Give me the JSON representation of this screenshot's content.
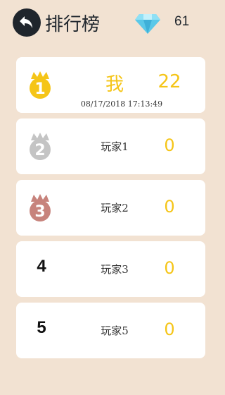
{
  "header": {
    "title": "排行榜",
    "gem_count": "61",
    "back_icon": "back-arrow-icon",
    "gem_icon": "diamond-icon"
  },
  "leaderboard": [
    {
      "rank": "1",
      "name": "我",
      "score": "22",
      "timestamp": "08/17/2018 17:13:49",
      "medal": "gold"
    },
    {
      "rank": "2",
      "name": "玩家1",
      "score": "0",
      "medal": "silver"
    },
    {
      "rank": "3",
      "name": "玩家2",
      "score": "0",
      "medal": "bronze"
    },
    {
      "rank": "4",
      "name": "玩家3",
      "score": "0"
    },
    {
      "rank": "5",
      "name": "玩家5",
      "score": "0"
    }
  ],
  "colors": {
    "background": "#f2e2d2",
    "card": "#ffffff",
    "gold": "#f5c518",
    "silver": "#c4c4c4",
    "bronze": "#c7837c",
    "dark": "#1f252c",
    "gem": "#5ac8e8"
  }
}
